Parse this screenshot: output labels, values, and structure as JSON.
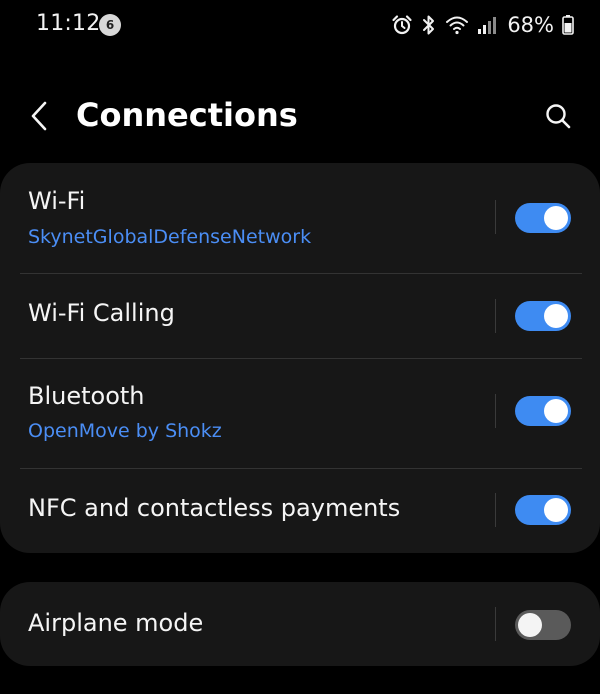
{
  "status_bar": {
    "time": "11:12",
    "notification_count": "6",
    "battery": "68%",
    "icons": [
      "alarm-icon",
      "bluetooth-icon",
      "wifi-icon",
      "signal-icon",
      "battery-icon"
    ]
  },
  "header": {
    "title": "Connections",
    "back_icon": "chevron-left-icon",
    "search_icon": "search-icon"
  },
  "colors": {
    "accent": "#3e8bf2",
    "subtitle": "#4b8ef5",
    "card_bg": "#171717",
    "background": "#000000"
  },
  "settings": [
    {
      "label": "Wi-Fi",
      "sub": "SkynetGlobalDefenseNetwork",
      "enabled": true
    },
    {
      "label": "Wi-Fi Calling",
      "sub": "",
      "enabled": true
    },
    {
      "label": "Bluetooth",
      "sub": "OpenMove by Shokz",
      "enabled": true
    },
    {
      "label": "NFC and contactless payments",
      "sub": "",
      "enabled": true
    }
  ],
  "airplane": {
    "label": "Airplane mode",
    "enabled": false
  }
}
